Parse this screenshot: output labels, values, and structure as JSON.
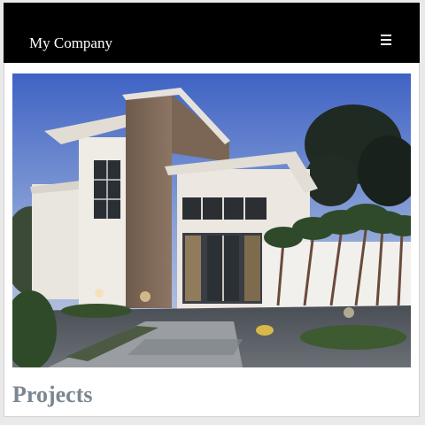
{
  "navbar": {
    "brand": "My Company",
    "menu_icon": "hamburger-menu-icon",
    "background": "#000000"
  },
  "hero": {
    "image_subject": "modern-house-photo"
  },
  "section": {
    "title": "Projects",
    "title_color": "#7a8791"
  }
}
